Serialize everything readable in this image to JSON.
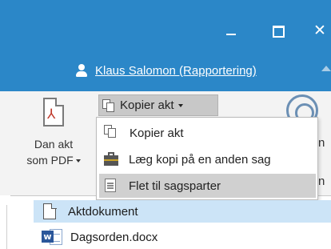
{
  "window": {
    "minimize_icon": "minimize-icon",
    "maximize_icon": "maximize-icon",
    "close_glyph": "✕"
  },
  "user": {
    "name": "Klaus Salomon (Rapportering)",
    "icon": "user-icon"
  },
  "ribbon": {
    "pdf_button": {
      "line1": "Dan akt",
      "line2": "som PDF",
      "icon": "pdf-icon"
    },
    "copy_dropdown": {
      "label": "Kopier akt",
      "icon": "copy-icon"
    },
    "partial_right_letters": [
      "n",
      "n"
    ]
  },
  "menu": {
    "items": [
      {
        "label": "Kopier akt",
        "icon": "copy-icon",
        "highlighted": false
      },
      {
        "label": "Læg kopi på en anden sag",
        "icon": "case-icon",
        "highlighted": false
      },
      {
        "label": "Flet til sagsparter",
        "icon": "merge-icon",
        "highlighted": true
      }
    ]
  },
  "files": [
    {
      "name": "Aktdokument",
      "icon": "document-icon",
      "selected": true
    },
    {
      "name": "Dagsorden.docx",
      "icon": "word-icon",
      "selected": false
    }
  ],
  "colors": {
    "titlebar": "#2b87c8",
    "selection": "#cce4f7",
    "menu_highlight": "#d0d0d0"
  }
}
